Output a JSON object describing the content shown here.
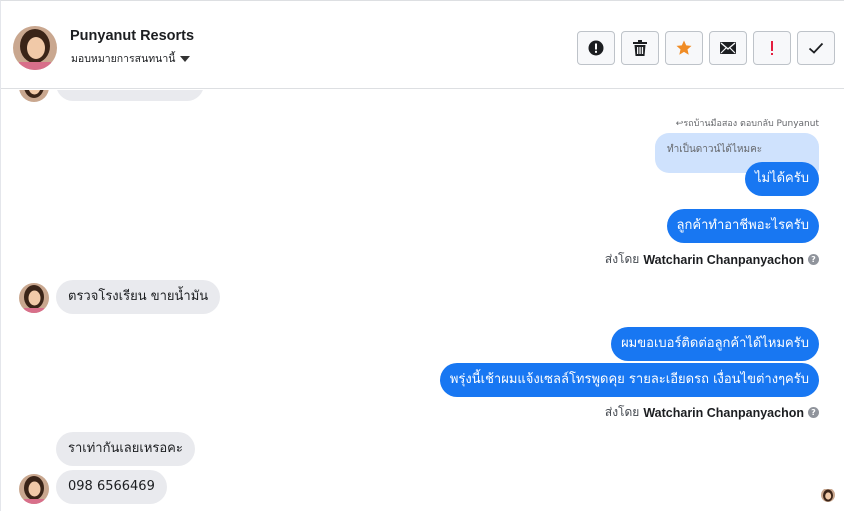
{
  "header": {
    "name": "Punyanut Resorts",
    "assign_label": "มอบหมายการสนทนานี้",
    "actions": [
      {
        "icon": "alert-circle-icon",
        "label": "!"
      },
      {
        "icon": "trash-icon",
        "label": ""
      },
      {
        "icon": "star-icon",
        "label": ""
      },
      {
        "icon": "mail-icon",
        "label": ""
      },
      {
        "icon": "exclamation-icon",
        "label": "!"
      },
      {
        "icon": "check-icon",
        "label": ""
      }
    ]
  },
  "colors": {
    "outgoing_bubble": "#1877f2",
    "incoming_bubble": "#e9eaee",
    "quoted_bubble": "#cfe2fd",
    "star": "#f08c25",
    "exclamation": "#e41e3f"
  },
  "messages": {
    "partial_top": "ทำไมได้ตามที่ต้องการ",
    "reply_note": "↩รถบ้านมือสอง ตอบกลับ Punyanut",
    "quoted_text": "ทำเป็นดาวน์ได้ไหมคะ",
    "out_1": "ไม่ได้ครับ",
    "out_2": "ลูกค้าทำอาชีพอะไรครับ",
    "sent_by_label": "ส่งโดย",
    "agent_name": "Watcharin Chanpanyachon",
    "help_mark": "?",
    "in_1": "ตรวจโรงเรียน ขายน้ำมัน",
    "out_3": "ผมขอเบอร์ติดต่อลูกค้าได้ไหมครับ",
    "out_4": "พรุ่งนี้เช้าผมแจ้งเซลล์โทรพูดคุย รายละเอียดรถ เงื่อนไขต่างๆครับ",
    "in_2": "ราเท่ากันเลยเหรอคะ",
    "in_3": "098 6566469"
  }
}
